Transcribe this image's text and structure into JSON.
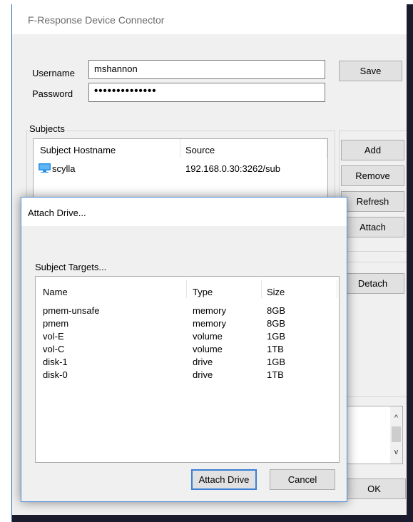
{
  "window": {
    "title": "F-Response Device Connector"
  },
  "credentials": {
    "username_label": "Username",
    "username_value": "mshannon",
    "password_label": "Password",
    "password_value": "••••••••••••••",
    "save_label": "Save"
  },
  "subjects": {
    "group_title": "Subjects",
    "columns": [
      "Subject Hostname",
      "Source"
    ],
    "rows": [
      {
        "hostname": "scylla",
        "source": "192.168.0.30:3262/sub"
      }
    ],
    "buttons": {
      "add": "Add",
      "remove": "Remove",
      "refresh": "Refresh",
      "attach": "Attach",
      "detach": "Detach"
    }
  },
  "ok_label": "OK",
  "dialog": {
    "title": "Attach Drive...",
    "section_label": "Subject Targets...",
    "columns": [
      "Name",
      "Type",
      "Size"
    ],
    "rows": [
      {
        "name": "pmem-unsafe",
        "type": "memory",
        "size": "8GB"
      },
      {
        "name": "pmem",
        "type": "memory",
        "size": "8GB"
      },
      {
        "name": "vol-E",
        "type": "volume",
        "size": "1GB"
      },
      {
        "name": "vol-C",
        "type": "volume",
        "size": "1TB"
      },
      {
        "name": "disk-1",
        "type": "drive",
        "size": "1GB"
      },
      {
        "name": "disk-0",
        "type": "drive",
        "size": "1TB"
      }
    ],
    "attach_drive_label": "Attach Drive",
    "cancel_label": "Cancel"
  },
  "colors": {
    "accent": "#3b7fd6",
    "window_border": "#2b6fb5",
    "desktop_dark": "#1b1b2e"
  },
  "icons": {
    "host": "computer-icon",
    "scroll_up": "chevron-up-icon",
    "scroll_down": "chevron-down-icon"
  }
}
